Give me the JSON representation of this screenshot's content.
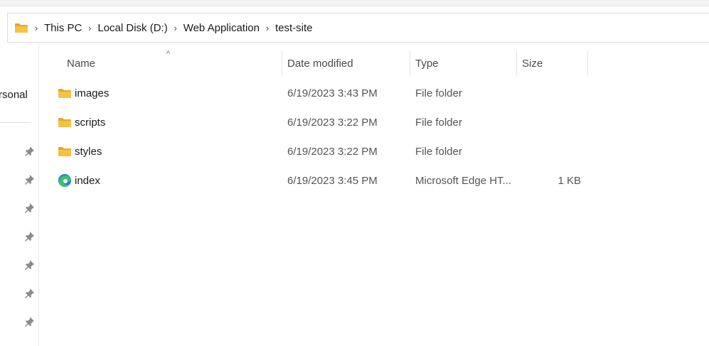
{
  "breadcrumb": {
    "items": [
      "This PC",
      "Local Disk (D:)",
      "Web Application",
      "test-site"
    ]
  },
  "sidebar": {
    "partial_label": "rsonal",
    "pins": [
      1,
      2,
      3,
      4,
      5,
      6,
      7
    ]
  },
  "columns": {
    "name": "Name",
    "date": "Date modified",
    "type": "Type",
    "size": "Size",
    "sort_indicator": "^"
  },
  "files": [
    {
      "icon": "folder-icon",
      "name": "images",
      "date": "6/19/2023 3:43 PM",
      "type": "File folder",
      "size": ""
    },
    {
      "icon": "folder-icon",
      "name": "scripts",
      "date": "6/19/2023 3:22 PM",
      "type": "File folder",
      "size": ""
    },
    {
      "icon": "folder-icon",
      "name": "styles",
      "date": "6/19/2023 3:22 PM",
      "type": "File folder",
      "size": ""
    },
    {
      "icon": "edge-icon",
      "name": "index",
      "date": "6/19/2023 3:45 PM",
      "type": "Microsoft Edge HT...",
      "size": "1 KB"
    }
  ],
  "colors": {
    "folder": "#f5c242",
    "folder_dark": "#e2a82a",
    "edge_blue": "#1f7fd6",
    "edge_green": "#3fbf6f"
  }
}
